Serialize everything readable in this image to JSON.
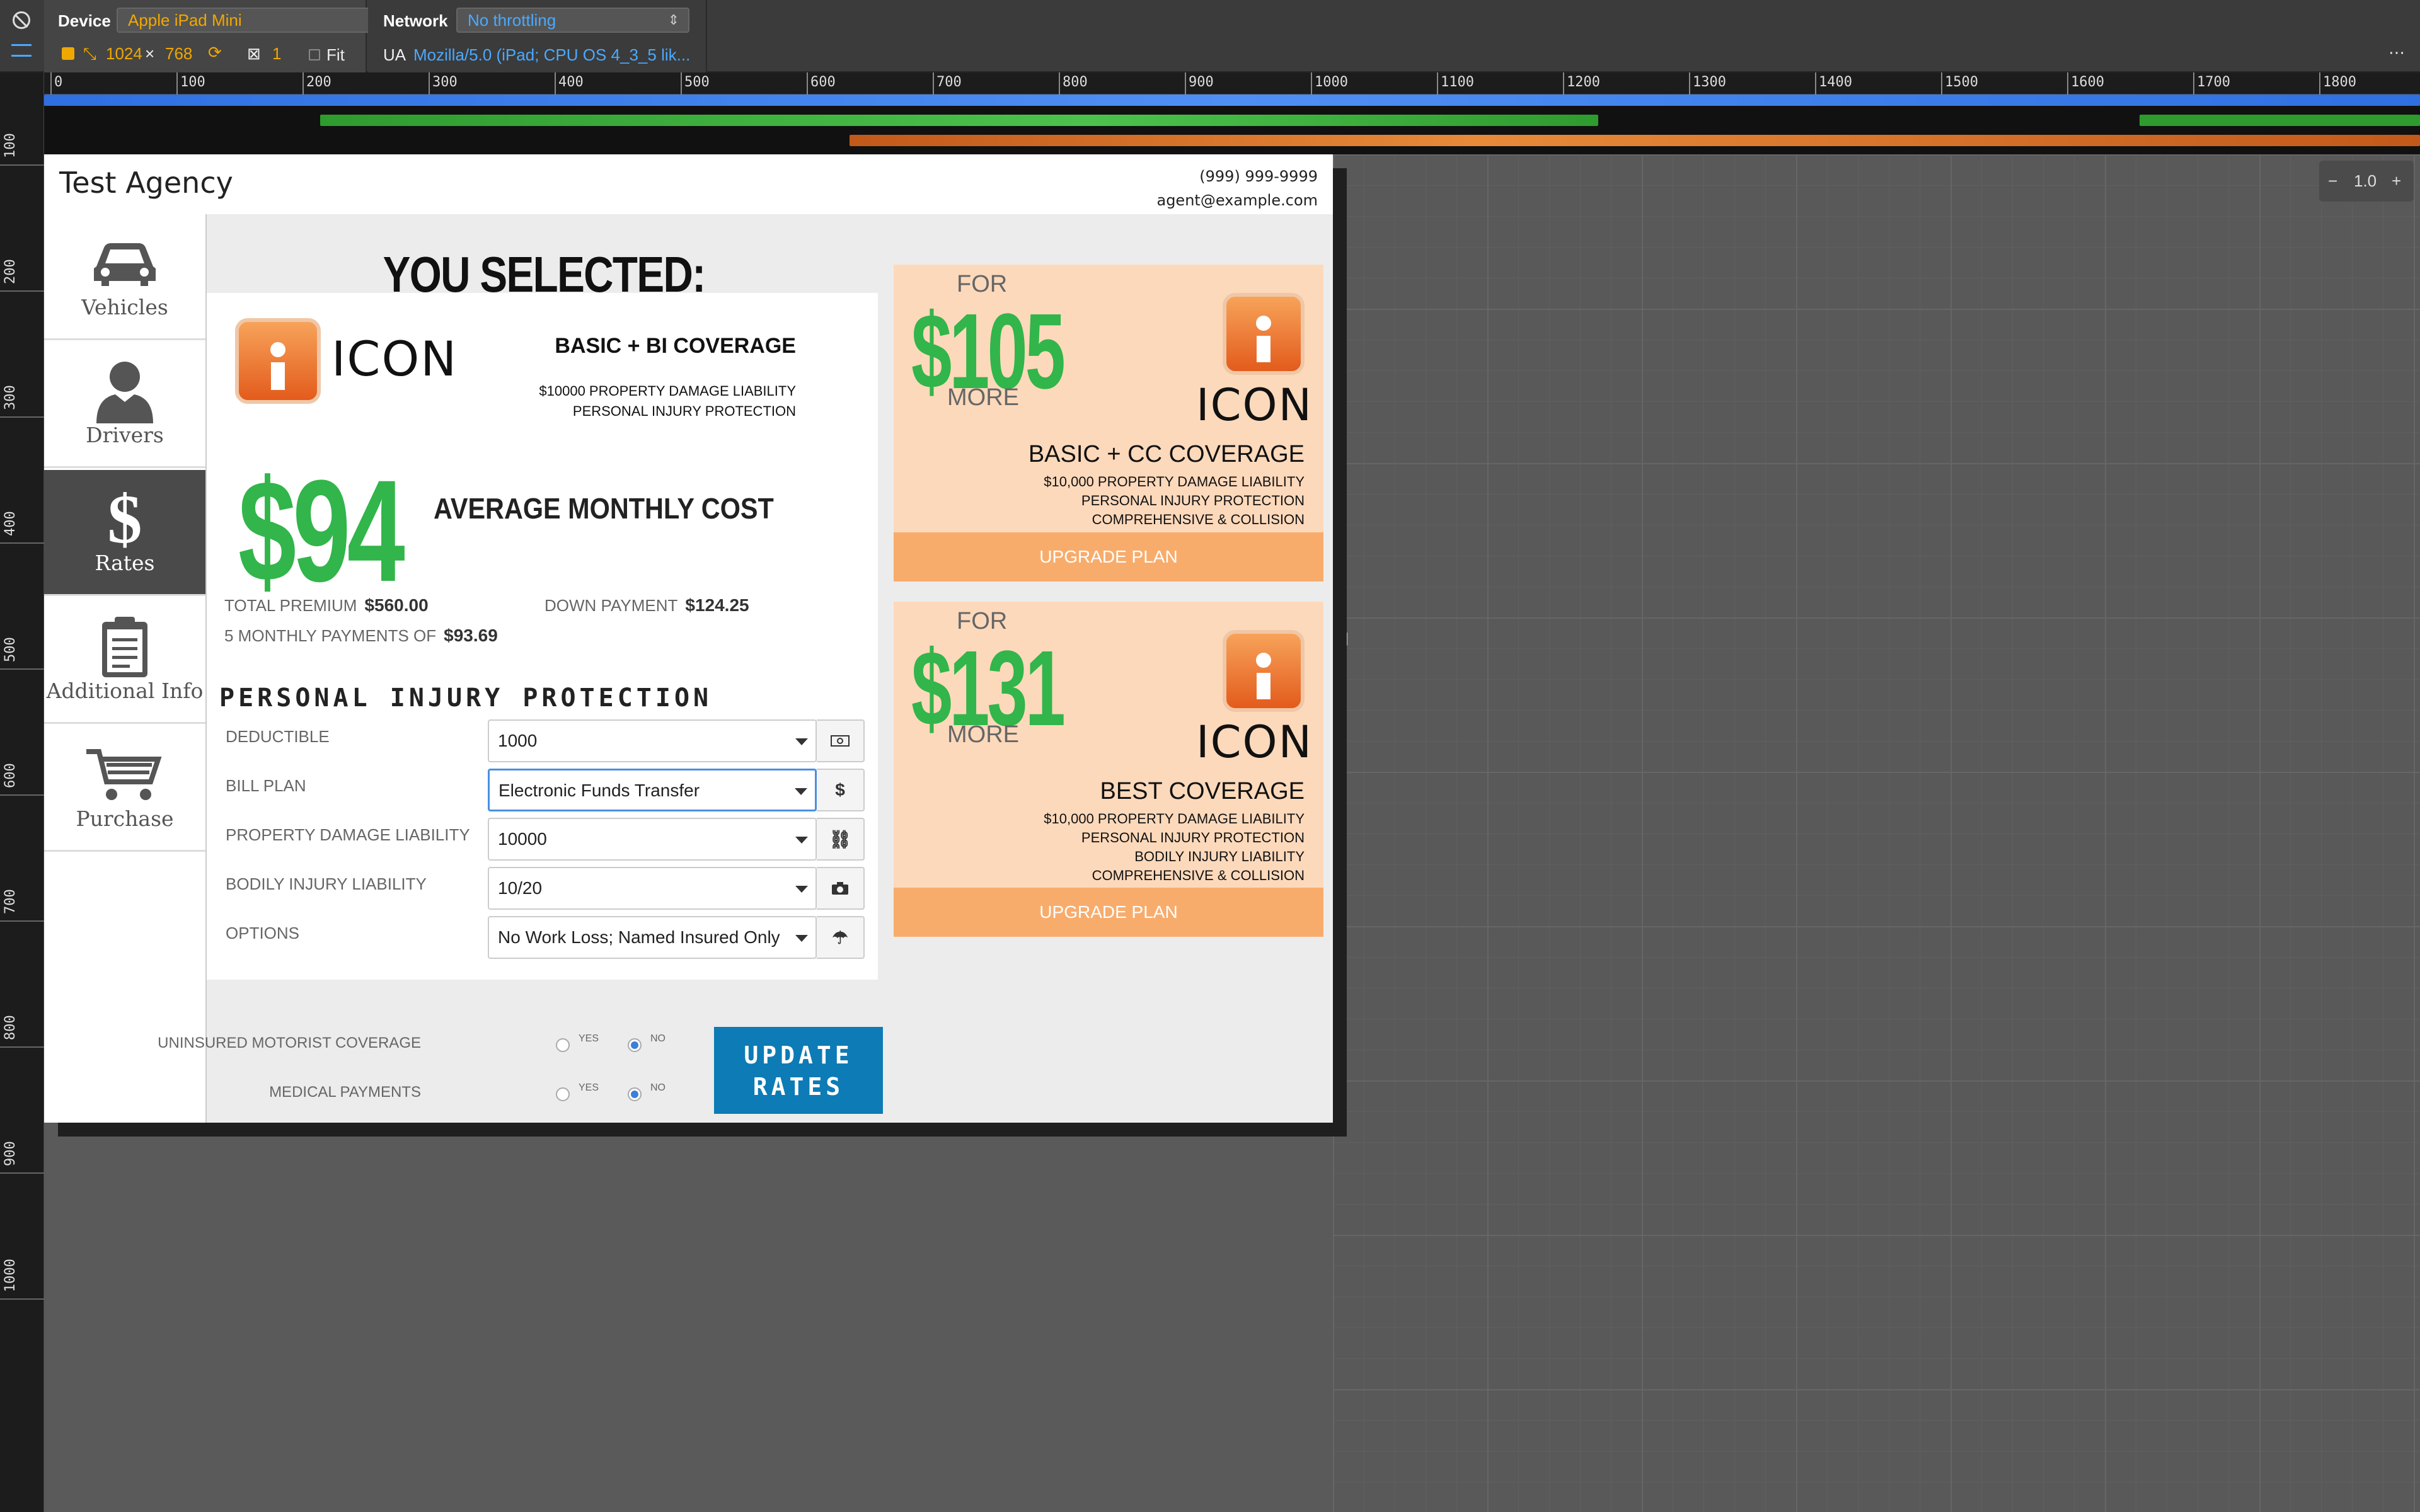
{
  "devtools": {
    "device_label": "Device",
    "device_value": "Apple iPad Mini",
    "network_label": "Network",
    "network_value": "No throttling",
    "width": "1024",
    "times": "×",
    "height": "768",
    "scale": "1",
    "fit_label": "Fit",
    "ua_label": "UA",
    "ua_value": "Mozilla/5.0 (iPad; CPU OS 4_3_5 lik...",
    "ruler_top": [
      "0",
      "100",
      "200",
      "300",
      "400",
      "500",
      "600",
      "700",
      "800",
      "900",
      "1000",
      "1100",
      "1200",
      "1300",
      "1400",
      "1500",
      "1600",
      "1700",
      "1800"
    ],
    "ruler_left": [
      "100",
      "200",
      "300",
      "400",
      "500",
      "600",
      "700",
      "800",
      "900",
      "1000"
    ],
    "zoom_minus": "−",
    "zoom_value": "1.0",
    "zoom_plus": "+",
    "colors": {
      "accent": "#f0a800",
      "link": "#4aa9ff",
      "bar_blue": "#2f6fe0",
      "bar_green": "#2e9b2e",
      "bar_orange": "#d4691e"
    }
  },
  "app": {
    "brand": "Test Agency",
    "phone": "(999) 999-9999",
    "email": "agent@example.com"
  },
  "sidebar": {
    "items": [
      {
        "label": "Vehicles",
        "icon": "car-icon",
        "active": false
      },
      {
        "label": "Drivers",
        "icon": "person-icon",
        "active": false
      },
      {
        "label": "Rates",
        "icon": "dollar-icon",
        "active": true
      },
      {
        "label": "Additional Info",
        "icon": "clipboard-icon",
        "active": false
      },
      {
        "label": "Purchase",
        "icon": "cart-icon",
        "active": false
      }
    ]
  },
  "selected": {
    "title": "YOU SELECTED:",
    "carrier": "ICON",
    "plan_name": "BASIC + BI COVERAGE",
    "plan_details": [
      "$10000 PROPERTY DAMAGE LIABILITY",
      "PERSONAL INJURY PROTECTION"
    ],
    "price": "$94",
    "price_caption": "AVERAGE MONTHLY COST",
    "total_premium_label": "TOTAL PREMIUM",
    "total_premium": "$560.00",
    "down_payment_label": "DOWN PAYMENT",
    "down_payment": "$124.25",
    "monthly_label": "5 MONTHLY PAYMENTS OF",
    "monthly": "$93.69"
  },
  "pip": {
    "title": "PERSONAL INJURY PROTECTION",
    "fields": [
      {
        "label": "DEDUCTIBLE",
        "value": "1000",
        "addon": "money-icon"
      },
      {
        "label": "BILL PLAN",
        "value": "Electronic Funds Transfer",
        "addon": "$"
      },
      {
        "label": "PROPERTY DAMAGE LIABILITY",
        "value": "10000",
        "addon": "unlink-icon"
      },
      {
        "label": "BODILY INJURY LIABILITY",
        "value": "10/20",
        "addon": "camera-icon"
      },
      {
        "label": "OPTIONS",
        "value": "No Work Loss; Named Insured Only",
        "addon": "umbrella-icon"
      }
    ]
  },
  "radios": {
    "uninsured_label": "UNINSURED MOTORIST COVERAGE",
    "medical_label": "MEDICAL PAYMENTS",
    "yes": "YES",
    "no": "NO",
    "uninsured_value": "NO",
    "medical_value": "NO"
  },
  "update_button": [
    "UPDATE",
    "RATES"
  ],
  "upgrades": [
    {
      "for": "FOR",
      "price": "$105",
      "more": "MORE",
      "carrier": "ICON",
      "name": "BASIC + CC COVERAGE",
      "details": [
        "$10,000 PROPERTY DAMAGE LIABILITY",
        "PERSONAL INJURY PROTECTION",
        "COMPREHENSIVE & COLLISION"
      ],
      "button": "UPGRADE PLAN"
    },
    {
      "for": "FOR",
      "price": "$131",
      "more": "MORE",
      "carrier": "ICON",
      "name": "BEST COVERAGE",
      "details": [
        "$10,000 PROPERTY DAMAGE LIABILITY",
        "PERSONAL INJURY PROTECTION",
        "BODILY INJURY LIABILITY",
        "COMPREHENSIVE & COLLISION"
      ],
      "button": "UPGRADE PLAN"
    }
  ]
}
